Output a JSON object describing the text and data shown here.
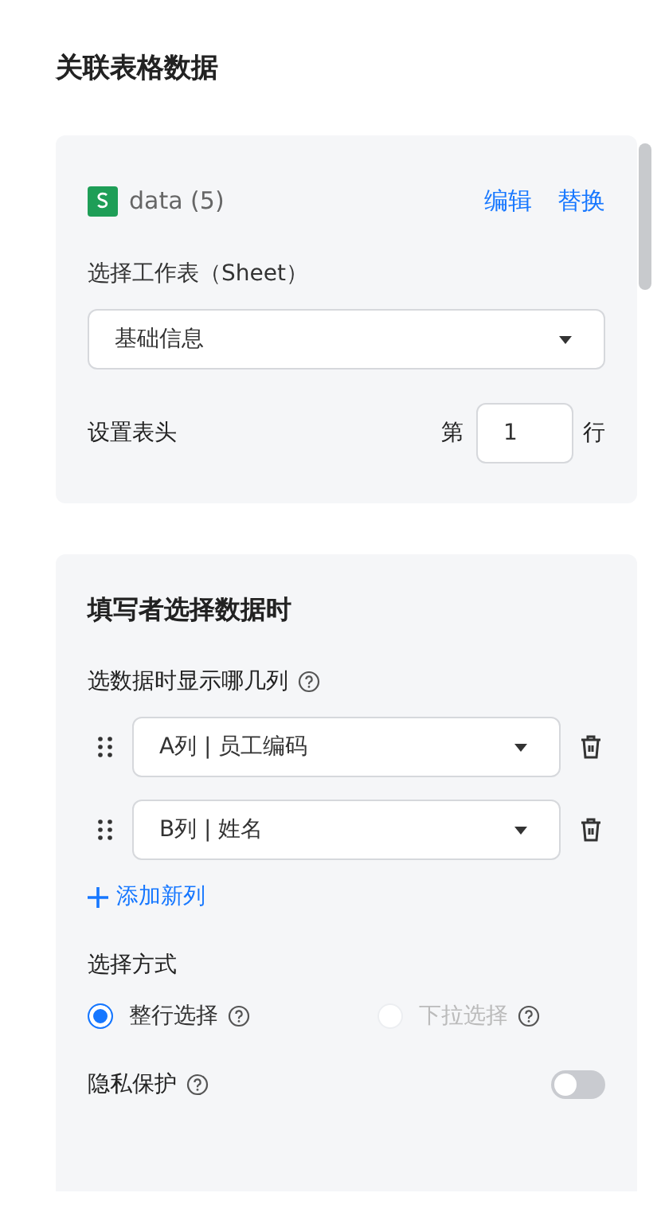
{
  "title": "关联表格数据",
  "table_source": {
    "file_name": "data (5)",
    "actions": [
      {
        "label": "编辑"
      },
      {
        "label": "替换"
      }
    ],
    "sheet_label": "选择工作表（Sheet）",
    "sheet_value": "基础信息",
    "header_label": "设置表头",
    "header_prefix": "第",
    "header_row": "1",
    "header_suffix": "行"
  },
  "selection": {
    "heading": "填写者选择数据时",
    "columns_label": "选数据时显示哪几列",
    "columns": [
      {
        "value": "A列 | 员工编码"
      },
      {
        "value": "B列 | 姓名"
      }
    ],
    "add_label": "添加新列",
    "mode_label": "选择方式",
    "modes": [
      {
        "label": "整行选择",
        "selected": true,
        "disabled": false
      },
      {
        "label": "下拉选择",
        "selected": false,
        "disabled": true
      }
    ],
    "privacy": {
      "label": "隐私保护",
      "on": false
    }
  }
}
